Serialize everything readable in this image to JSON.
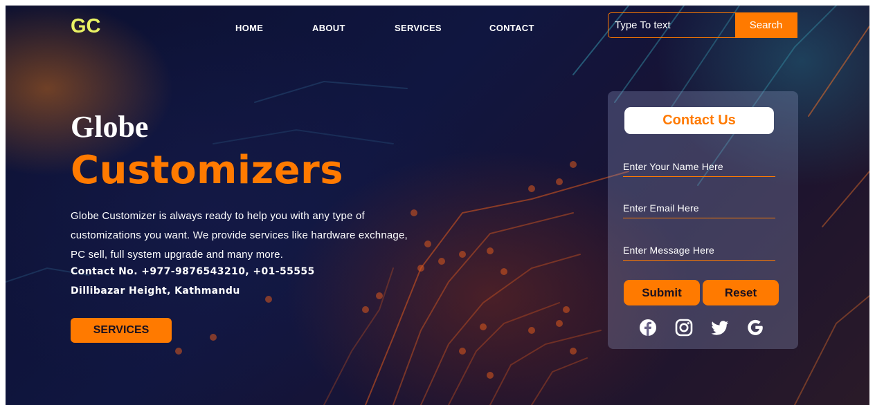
{
  "brand": {
    "logo": "GC"
  },
  "nav": {
    "items": [
      "HOME",
      "ABOUT",
      "SERVICES",
      "CONTACT"
    ]
  },
  "search": {
    "placeholder": "Type To text",
    "button_label": "Search"
  },
  "hero": {
    "title_line1": "Globe",
    "title_line2": "Customizers",
    "description": "Globe Customizer is always ready to help you with any type of customizations you want. We provide services like hardware exchnage, PC sell, full system upgrade and many more.",
    "contact_line": "Contact No. +977-9876543210, +01-55555",
    "address_line": "Dillibazar Height, Kathmandu",
    "services_button": "SERVICES"
  },
  "contact_form": {
    "title": "Contact Us",
    "name_placeholder": "Enter Your Name Here",
    "email_placeholder": "Enter Email Here",
    "message_placeholder": "Enter Message Here",
    "submit_label": "Submit",
    "reset_label": "Reset",
    "social_icons": [
      "facebook-icon",
      "instagram-icon",
      "twitter-icon",
      "google-icon"
    ]
  },
  "colors": {
    "accent": "#ff7a00",
    "logo": "#e9f263",
    "text": "#ffffff"
  }
}
